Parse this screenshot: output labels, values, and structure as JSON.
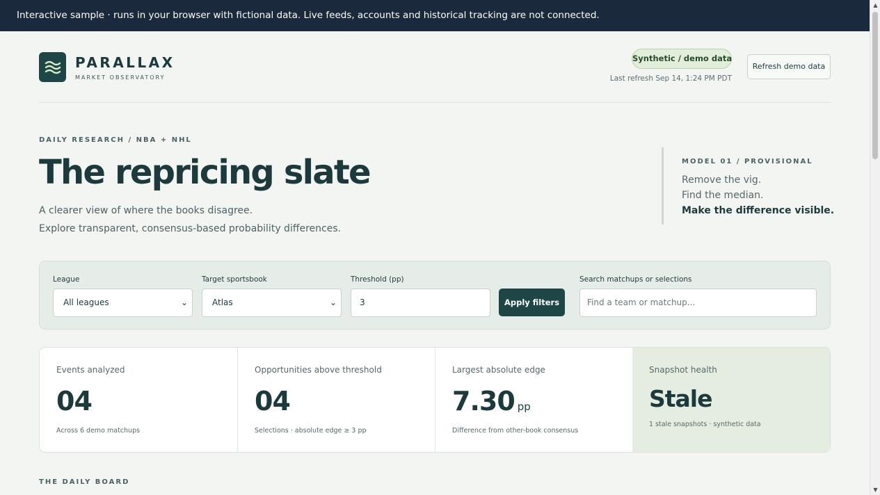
{
  "banner": {
    "text": "Interactive sample · runs in your browser with fictional data. Live feeds, accounts and historical tracking are not connected."
  },
  "brand": {
    "name": "PARALLAX",
    "tagline": "MARKET OBSERVATORY",
    "logo_icon": "waves-icon"
  },
  "header": {
    "badge": "Synthetic / demo data",
    "last_refresh": "Last refresh Sep 14, 1:24 PM PDT",
    "refresh_button": "Refresh demo data"
  },
  "hero": {
    "eyebrow": "DAILY RESEARCH / NBA + NHL",
    "title": "The repricing slate",
    "line1": "A clearer view of where the books disagree.",
    "line2": "Explore transparent, consensus-based probability differences."
  },
  "model": {
    "eyebrow": "MODEL 01 / PROVISIONAL",
    "line1": "Remove the vig.",
    "line2": "Find the median.",
    "line3": "Make the difference visible."
  },
  "filters": {
    "league_label": "League",
    "league_value": "All leagues",
    "sportsbook_label": "Target sportsbook",
    "sportsbook_value": "Atlas",
    "threshold_label": "Threshold (pp)",
    "threshold_value": "3",
    "apply_button": "Apply filters",
    "search_label": "Search matchups or selections",
    "search_placeholder": "Find a team or matchup..."
  },
  "stats": [
    {
      "label": "Events analyzed",
      "value": "04",
      "unit": "",
      "note": "Across 6 demo matchups"
    },
    {
      "label": "Opportunities above threshold",
      "value": "04",
      "unit": "",
      "note": "Selections · absolute edge ≥ 3 pp"
    },
    {
      "label": "Largest absolute edge",
      "value": "7.30",
      "unit": "pp",
      "note": "Difference from other-book consensus"
    },
    {
      "label": "Snapshot health",
      "value": "Stale",
      "unit": "",
      "note": "1 stale snapshots · synthetic data"
    }
  ],
  "board": {
    "title": "THE DAILY BOARD"
  },
  "colors": {
    "banner_bg": "#1a2a3c",
    "brand": "#1f4647",
    "accent_green": "#e2eed9",
    "page_bg": "#f3f5f2"
  }
}
